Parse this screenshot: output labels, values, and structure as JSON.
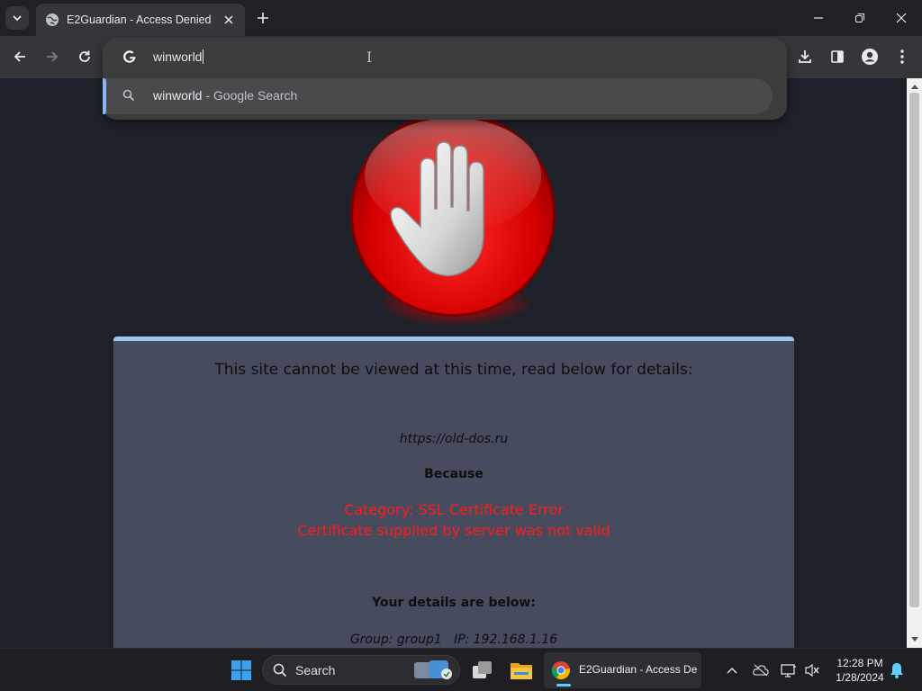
{
  "browser": {
    "tab": {
      "title": "E2Guardian - Access Denied"
    },
    "omnibox": {
      "value": "winworld",
      "suggestion": {
        "query": "winworld",
        "suffix": " - Google Search"
      }
    }
  },
  "page": {
    "heading": "This site cannot be viewed at this time, read below for details:",
    "url": "https://old-dos.ru",
    "because": "Because",
    "category": "Category: SSL Certificate Error",
    "reason": "Certificate supplied by server was not valid",
    "details_heading": "Your details are below:",
    "group_line": "Group: group1   IP: 192.168.1.16"
  },
  "taskbar": {
    "search_label": "Search",
    "chrome_task_label": "E2Guardian - Access De",
    "clock_time": "12:28 PM",
    "clock_date": "1/28/2024"
  },
  "colors": {
    "accent": "#8ab4f8",
    "panel_border": "#9cc4ec",
    "error_text": "#ff1a1a",
    "stop_red": "#d40000"
  },
  "icons": [
    "tab-list-icon",
    "globe-icon",
    "close-icon",
    "plus-icon",
    "minimize-icon",
    "restore-icon",
    "back-arrow-icon",
    "forward-arrow-icon",
    "reload-icon",
    "google-g-icon",
    "search-icon",
    "download-icon",
    "side-panel-icon",
    "profile-icon",
    "more-icon",
    "stop-hand-icon",
    "windows-start-icon",
    "task-view-icon",
    "file-explorer-icon",
    "chrome-icon",
    "chevron-up-icon",
    "onedrive-icon",
    "display-icon",
    "volume-muted-icon",
    "bell-icon"
  ]
}
